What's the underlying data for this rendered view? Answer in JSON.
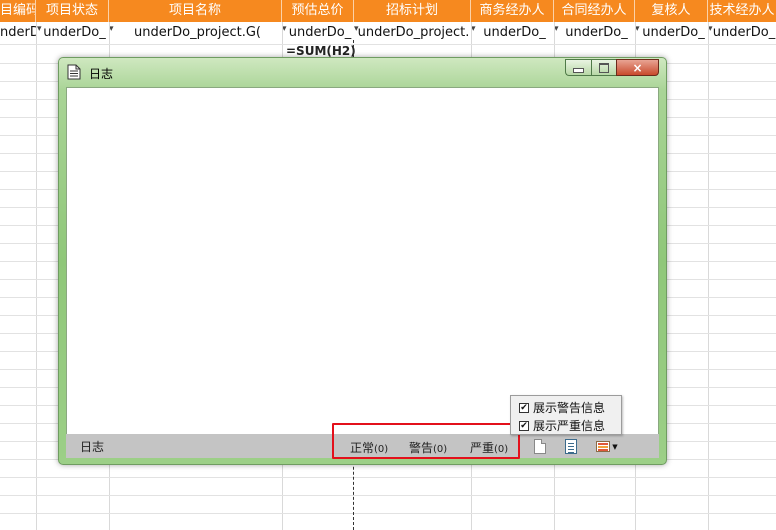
{
  "spreadsheet": {
    "headers": [
      "目编码",
      "项目状态",
      "项目名称",
      "预估总价",
      "招标计划",
      "商务经办人",
      "合同经办人",
      "复核人",
      "技术经办人"
    ],
    "row1": [
      "nderD",
      "underDo_",
      "underDo_project.G(",
      "underDo_",
      "underDo_project.",
      "underDo_",
      "underDo_",
      "underDo_",
      "underDo_"
    ],
    "formula": "=SUM(H2)"
  },
  "colors": {
    "header_bg": "#f6891f",
    "window_frame": "#8fc779",
    "highlight_box": "#e3101b",
    "statusbar_bg": "#c4c4c4"
  },
  "log_window": {
    "title": "日志",
    "title_icon": "document-icon",
    "buttons": {
      "minimize": "minimize-icon",
      "maximize": "maximize-icon",
      "close": "×"
    },
    "statusbar": {
      "label": "日志",
      "normal_label": "正常",
      "normal_count": "(0)",
      "warning_label": "警告",
      "warning_count": "(0)",
      "severe_label": "严重",
      "severe_count": "(0)",
      "buttons": [
        "new-doc-icon",
        "list-doc-icon",
        "grid-menu-icon"
      ]
    },
    "filter_menu": {
      "items": [
        {
          "label": "展示警告信息",
          "checked": true
        },
        {
          "label": "展示严重信息",
          "checked": true
        }
      ]
    }
  }
}
